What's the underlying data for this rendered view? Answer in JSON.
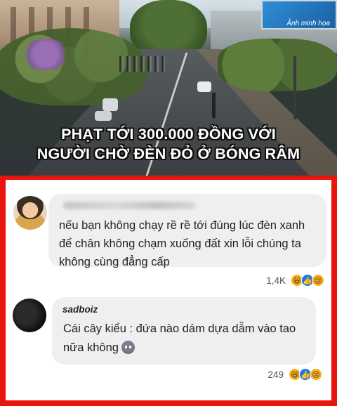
{
  "header": {
    "photo_caption": "Ảnh minh họa",
    "headline_line1": "PHẠT TỚI 300.000 ĐỒNG VỚI",
    "headline_line2": "NGƯỜI CHỜ ĐÈN ĐỎ Ở BÓNG RÂM"
  },
  "comments": [
    {
      "author": "",
      "text": "nếu bạn không chạy rề rề tới đúng lúc đèn xanh để chân không chạm xuống đất xin lỗi chúng ta không cùng đẳng cấp",
      "reaction_count": "1,4K",
      "reactions": [
        "haha",
        "like",
        "sad"
      ]
    },
    {
      "author": "sadboiz",
      "text": "Cái cây kiểu : đứa nào dám dựa dẫm vào tao nữa không",
      "reaction_count": "249",
      "reactions": [
        "haha",
        "like",
        "sad"
      ]
    }
  ],
  "icons": {
    "haha": "😆",
    "like": "👍",
    "sad": "😢"
  },
  "colors": {
    "frame_red": "#e8150f",
    "bubble_gray": "#efefef",
    "like_blue": "#1877f2",
    "emoji_yellow": "#f7b125"
  }
}
